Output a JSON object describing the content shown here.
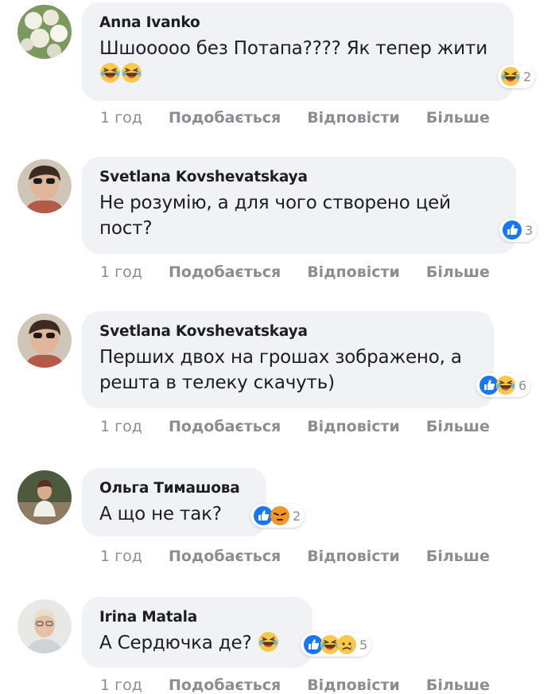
{
  "comments": [
    {
      "author": "Anna Ivanko",
      "text": "Шшооооо без Потапа???? Як тепер жити",
      "reaction_count": "2",
      "reactions": [
        "laugh-icon"
      ],
      "time": "1 год",
      "like": "Подобається",
      "reply": "Відповісти",
      "more": "Більше"
    },
    {
      "author": "Svetlana Kovshevatskaya",
      "text": "Не розумію, а для чого створено цей пост?",
      "reaction_count": "3",
      "reactions": [
        "like-icon"
      ],
      "time": "1 год",
      "like": "Подобається",
      "reply": "Відповісти",
      "more": "Більше"
    },
    {
      "author": "Svetlana Kovshevatskaya",
      "text": "Перших двох на грошах зображено, а решта в телеку скачуть)",
      "reaction_count": "6",
      "reactions": [
        "like-icon",
        "laugh-icon"
      ],
      "time": "1 год",
      "like": "Подобається",
      "reply": "Відповісти",
      "more": "Більше"
    },
    {
      "author": "Ольга Тимашова",
      "text": "А що не так?",
      "reaction_count": "2",
      "reactions": [
        "like-icon",
        "angry-icon"
      ],
      "time": "1 год",
      "like": "Подобається",
      "reply": "Відповісти",
      "more": "Більше"
    },
    {
      "author": "Irina Matala",
      "text": "А Сердючка де?",
      "reaction_count": "5",
      "reactions": [
        "like-icon",
        "laugh-icon",
        "sad-icon"
      ],
      "time": "1 год",
      "like": "Подобається",
      "reply": "Відповісти",
      "more": "Більше"
    }
  ],
  "colors": {
    "bubble": "#f0f2f5",
    "text": "#1c1e21",
    "meta": "#8a8d91",
    "like_blue": "#1877f2",
    "emoji_yellow": "#f7c94b",
    "angry_red": "#e9710f"
  }
}
